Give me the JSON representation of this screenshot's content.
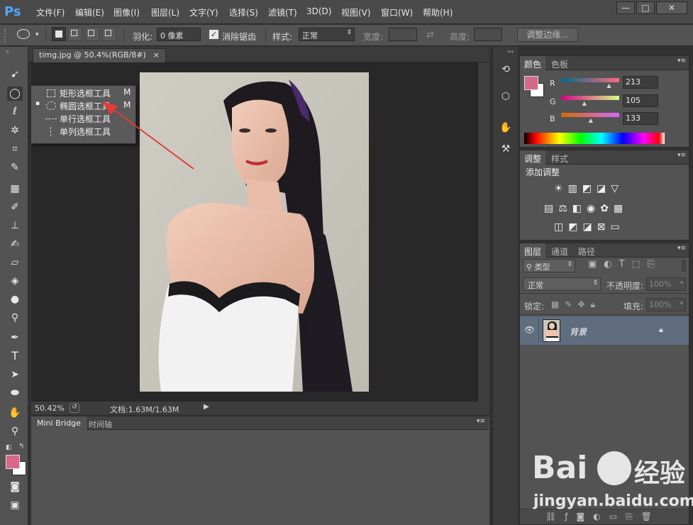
{
  "app": {
    "logo": "Ps"
  },
  "menubar": {
    "items": [
      "文件(F)",
      "编辑(E)",
      "图像(I)",
      "图层(L)",
      "文字(Y)",
      "选择(S)",
      "滤镜(T)",
      "3D(D)",
      "视图(V)",
      "窗口(W)",
      "帮助(H)"
    ],
    "window_buttons": [
      "—",
      "□",
      "✕"
    ]
  },
  "options_bar": {
    "feather_label": "羽化:",
    "feather_value": "0 像素",
    "antialias_label": "消除锯齿",
    "style_label": "样式:",
    "style_value": "正常",
    "width_label": "宽度:",
    "height_label": "高度:",
    "refine_button": "调整边缘..."
  },
  "document": {
    "tab_title": "timg.jpg @ 50.4%(RGB/8#)",
    "tab_close": "×",
    "zoom": "50.42%",
    "doc_info": "文档:1.63M/1.63M"
  },
  "flyout": {
    "items": [
      {
        "label": "矩形选框工具",
        "shortcut": "M",
        "selected": false
      },
      {
        "label": "椭圆选框工具",
        "shortcut": "M",
        "selected": true
      },
      {
        "label": "单行选框工具",
        "shortcut": "",
        "selected": false
      },
      {
        "label": "单列选框工具",
        "shortcut": "",
        "selected": false
      }
    ]
  },
  "bottom_panel": {
    "tabs": [
      "Mini Bridge",
      "时间轴"
    ]
  },
  "color_panel": {
    "tabs": [
      "颜色",
      "色板"
    ],
    "foreground": "#d5698a",
    "r_label": "R",
    "g_label": "G",
    "b_label": "B",
    "r": 213,
    "g": 105,
    "b": 133,
    "r_text": "213",
    "g_text": "105",
    "b_text": "133"
  },
  "adjust_panel": {
    "tabs": [
      "调整",
      "样式"
    ],
    "title": "添加调整"
  },
  "layers_panel": {
    "tabs": [
      "图层",
      "通道",
      "路径"
    ],
    "filter_kind": "类型",
    "blend_mode": "正常",
    "opacity_label": "不透明度:",
    "opacity_value": "100%",
    "lock_label": "锁定:",
    "fill_label": "填充:",
    "fill_value": "100%",
    "layer_name": "背景"
  },
  "watermark": {
    "brand": "Bai",
    "brand2": "经验",
    "url": "jingyan.baidu.com"
  }
}
